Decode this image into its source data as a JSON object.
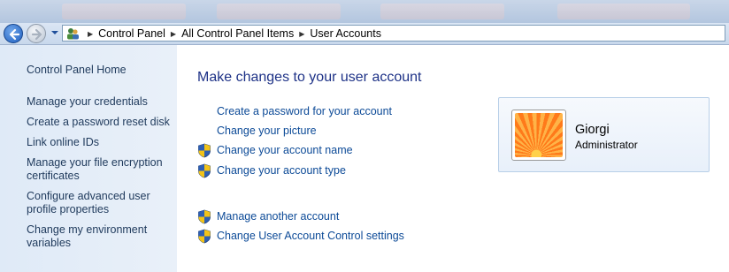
{
  "breadcrumb": {
    "items": [
      "Control Panel",
      "All Control Panel Items",
      "User Accounts"
    ]
  },
  "leftpane": {
    "home": "Control Panel Home",
    "items": [
      "Manage your credentials",
      "Create a password reset disk",
      "Link online IDs",
      "Manage your file encryption certificates",
      "Configure advanced user profile properties",
      "Change my environment variables"
    ]
  },
  "main": {
    "title": "Make changes to your user account",
    "tasks": [
      "Create a password for your account",
      "Change your picture",
      "Change your account name",
      "Change your account type"
    ],
    "other_tasks": [
      "Manage another account",
      "Change User Account Control settings"
    ]
  },
  "account": {
    "name": "Giorgi",
    "role": "Administrator"
  },
  "colors": {
    "link": "#0c4a97",
    "title": "#1e3287",
    "nav_link": "#1e395b",
    "pane_bg": "#dfeaf7"
  }
}
